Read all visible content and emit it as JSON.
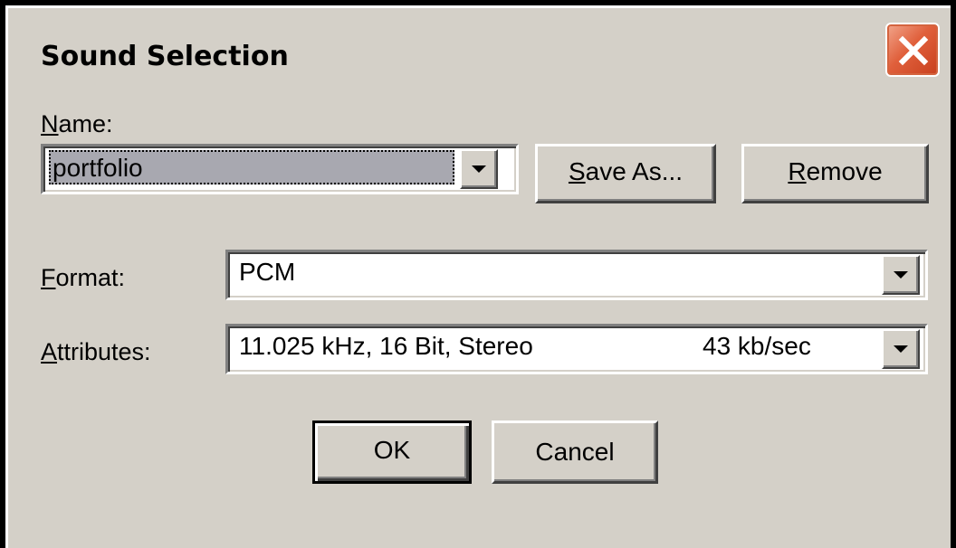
{
  "window": {
    "title": "Sound Selection",
    "close_icon": "close-icon"
  },
  "name": {
    "label_mnemonic": "N",
    "label_rest": "ame:",
    "value": "portfolio"
  },
  "buttons": {
    "save_as_mnemonic": "S",
    "save_as_rest": "ave As...",
    "remove_mnemonic": "R",
    "remove_rest": "emove",
    "ok": "OK",
    "cancel": "Cancel"
  },
  "format": {
    "label_mnemonic": "F",
    "label_rest": "ormat:",
    "value": "PCM"
  },
  "attributes": {
    "label_mnemonic": "A",
    "label_rest": "ttributes:",
    "value": "11.025 kHz, 16 Bit, Stereo",
    "rate": "43 kb/sec"
  },
  "colors": {
    "dialog_face": "#d4d0c8",
    "close_button": "#e0603c",
    "selection": "#a8a8b0"
  }
}
